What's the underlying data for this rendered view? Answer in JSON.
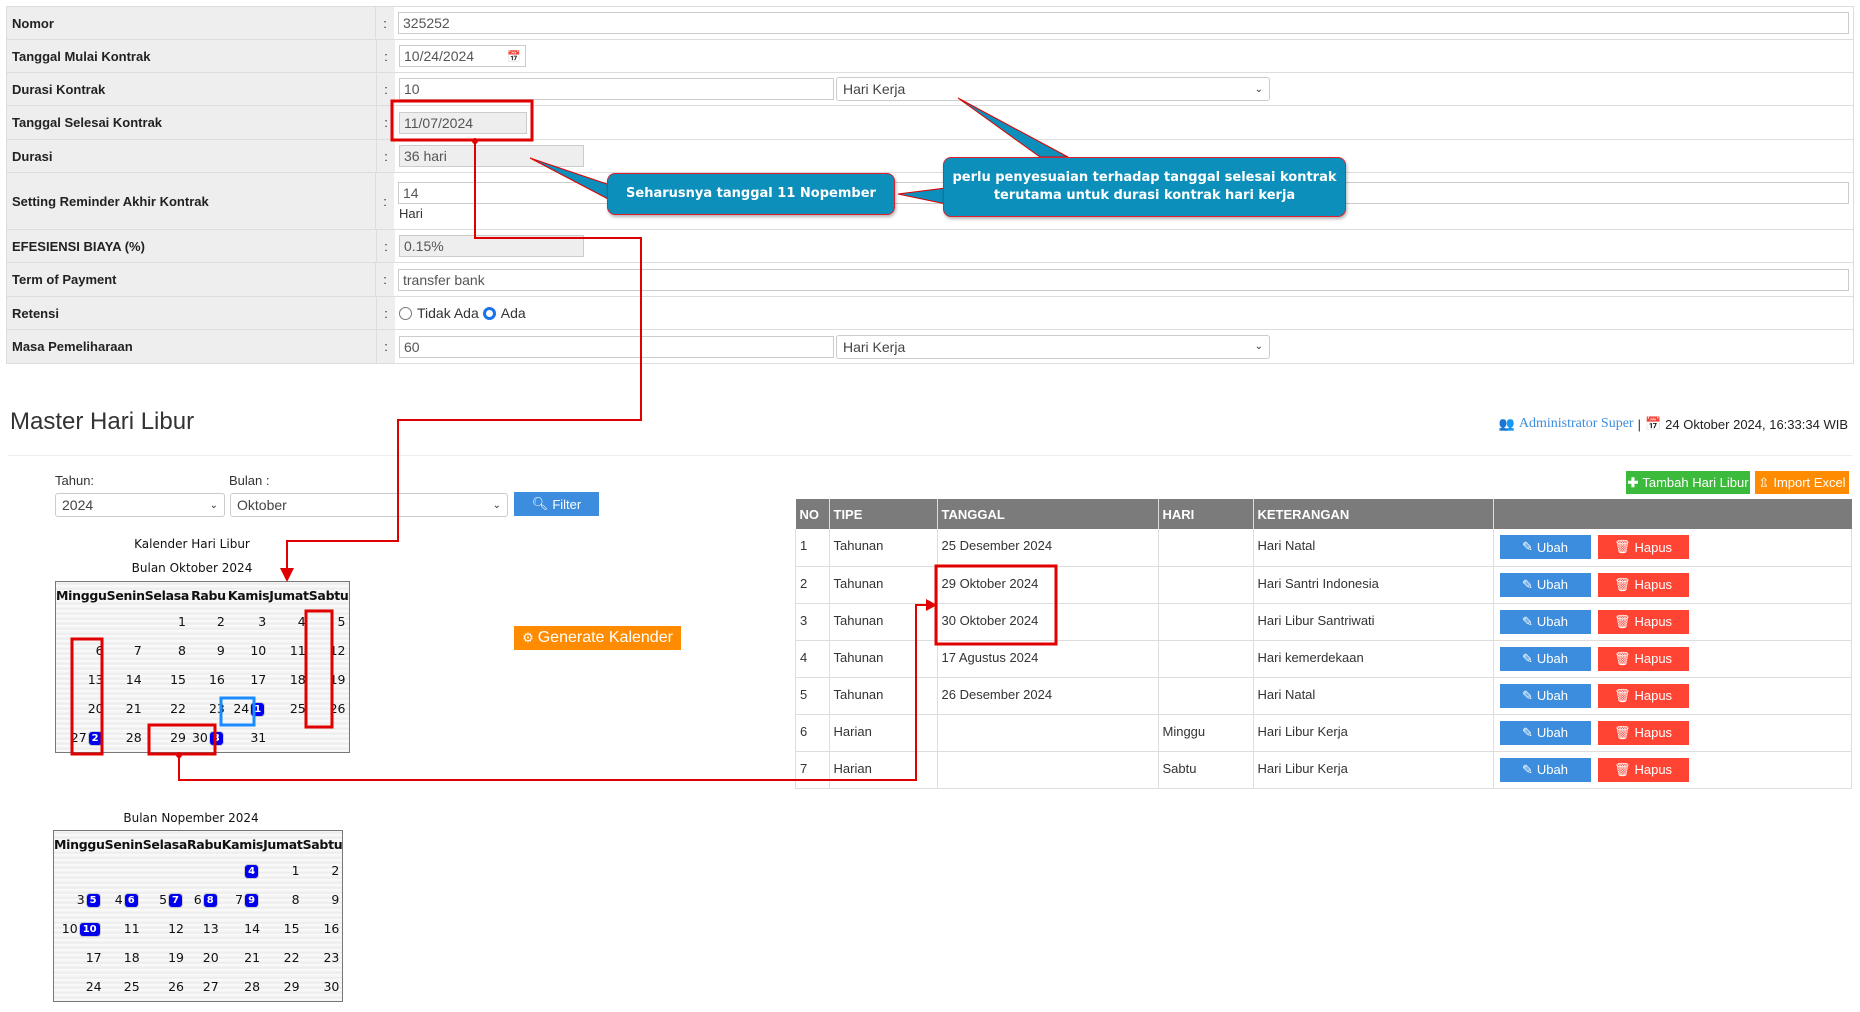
{
  "form": {
    "rows": [
      {
        "label": "Nomor",
        "value": "325252"
      },
      {
        "label": "Tanggal Mulai Kontrak",
        "value": "10/24/2024"
      },
      {
        "label": "Durasi Kontrak",
        "value": "10",
        "unit": "Hari Kerja"
      },
      {
        "label": "Tanggal Selesai Kontrak",
        "value": "11/07/2024"
      },
      {
        "label": "Durasi",
        "value": "36 hari"
      },
      {
        "label": "Setting Reminder Akhir Kontrak",
        "value": "14",
        "unit": "Hari"
      },
      {
        "label": "EFESIENSI BIAYA (%)",
        "value": "0.15%"
      },
      {
        "label": "Term of Payment",
        "value": "transfer bank"
      },
      {
        "label": "Retensi",
        "option1": "Tidak Ada",
        "option2": "Ada",
        "selected": "Ada"
      },
      {
        "label": "Masa Pemeliharaan",
        "value": "60",
        "unit": "Hari Kerja"
      }
    ],
    "colon": ":"
  },
  "annotations": {
    "callout1": "Seharusnya tanggal 11 Nopember",
    "callout2_line1": "perlu penyesuaian terhadap tanggal selesai kontrak",
    "callout2_line2": "terutama untuk durasi kontrak hari kerja",
    "color": "#e00000"
  },
  "header": {
    "title": "Master Hari Libur",
    "user": "Administrator Super",
    "separator": "|",
    "datetime": "24 Oktober 2024, 16:33:34 WIB"
  },
  "filter": {
    "tahun_label": "Tahun:",
    "tahun_value": "2024",
    "bulan_label": "Bulan :",
    "bulan_value": "Oktober",
    "filter_button": "Filter"
  },
  "buttons": {
    "tambah": "Tambah Hari Libur",
    "import": "Import Excel",
    "generate": "Generate Kalender"
  },
  "calendar": {
    "title": "Kalender Hari Libur",
    "days": [
      "Minggu",
      "Senin",
      "Selasa",
      "Rabu",
      "Kamis",
      "Jumat",
      "Sabtu"
    ],
    "months": [
      {
        "title": "Bulan Oktober 2024",
        "weeks": [
          [
            [
              "",
              ""
            ],
            [
              "",
              ""
            ],
            [
              "1",
              ""
            ],
            [
              "2",
              ""
            ],
            [
              "3",
              ""
            ],
            [
              "4",
              ""
            ],
            [
              "5",
              ""
            ]
          ],
          [
            [
              "6",
              ""
            ],
            [
              "7",
              ""
            ],
            [
              "8",
              ""
            ],
            [
              "9",
              ""
            ],
            [
              "10",
              ""
            ],
            [
              "11",
              ""
            ],
            [
              "12",
              ""
            ]
          ],
          [
            [
              "13",
              ""
            ],
            [
              "14",
              ""
            ],
            [
              "15",
              ""
            ],
            [
              "16",
              ""
            ],
            [
              "17",
              ""
            ],
            [
              "18",
              ""
            ],
            [
              "19",
              ""
            ]
          ],
          [
            [
              "20",
              ""
            ],
            [
              "21",
              ""
            ],
            [
              "22",
              ""
            ],
            [
              "23",
              ""
            ],
            [
              "24",
              "1"
            ],
            [
              "25",
              ""
            ],
            [
              "26",
              ""
            ]
          ],
          [
            [
              "27",
              "2"
            ],
            [
              "28",
              ""
            ],
            [
              "29",
              ""
            ],
            [
              "30",
              "3"
            ],
            [
              "31",
              ""
            ],
            [
              "",
              ""
            ],
            [
              "",
              ""
            ]
          ]
        ]
      },
      {
        "title": "Bulan Nopember 2024",
        "weeks": [
          [
            [
              "",
              ""
            ],
            [
              "",
              ""
            ],
            [
              "",
              ""
            ],
            [
              "",
              ""
            ],
            [
              "",
              "4"
            ],
            [
              "1",
              ""
            ],
            [
              "2",
              ""
            ]
          ],
          [
            [
              "3",
              "5"
            ],
            [
              "4",
              "6"
            ],
            [
              "5",
              "7"
            ],
            [
              "6",
              "8"
            ],
            [
              "7",
              "9"
            ],
            [
              "8",
              ""
            ],
            [
              "9",
              ""
            ]
          ],
          [
            [
              "10",
              "10"
            ],
            [
              "11",
              ""
            ],
            [
              "12",
              ""
            ],
            [
              "13",
              ""
            ],
            [
              "14",
              ""
            ],
            [
              "15",
              ""
            ],
            [
              "16",
              ""
            ]
          ],
          [
            [
              "17",
              ""
            ],
            [
              "18",
              ""
            ],
            [
              "19",
              ""
            ],
            [
              "20",
              ""
            ],
            [
              "21",
              ""
            ],
            [
              "22",
              ""
            ],
            [
              "23",
              ""
            ]
          ],
          [
            [
              "24",
              ""
            ],
            [
              "25",
              ""
            ],
            [
              "26",
              ""
            ],
            [
              "27",
              ""
            ],
            [
              "28",
              ""
            ],
            [
              "29",
              ""
            ],
            [
              "30",
              ""
            ]
          ]
        ]
      }
    ]
  },
  "table": {
    "headers": [
      "NO",
      "TIPE",
      "TANGGAL",
      "HARI",
      "KETERANGAN",
      ""
    ],
    "rows": [
      {
        "no": "1",
        "tipe": "Tahunan",
        "tanggal": "25 Desember 2024",
        "hari": "",
        "ket": "Hari Natal"
      },
      {
        "no": "2",
        "tipe": "Tahunan",
        "tanggal": "29 Oktober 2024",
        "hari": "",
        "ket": "Hari Santri Indonesia"
      },
      {
        "no": "3",
        "tipe": "Tahunan",
        "tanggal": "30 Oktober 2024",
        "hari": "",
        "ket": "Hari Libur Santriwati"
      },
      {
        "no": "4",
        "tipe": "Tahunan",
        "tanggal": "17 Agustus 2024",
        "hari": "",
        "ket": "Hari kemerdekaan"
      },
      {
        "no": "5",
        "tipe": "Tahunan",
        "tanggal": "26 Desember 2024",
        "hari": "",
        "ket": "Hari Natal"
      },
      {
        "no": "6",
        "tipe": "Harian",
        "tanggal": "",
        "hari": "Minggu",
        "ket": "Hari Libur Kerja"
      },
      {
        "no": "7",
        "tipe": "Harian",
        "tanggal": "",
        "hari": "Sabtu",
        "ket": "Hari Libur Kerja"
      }
    ],
    "edit_label": "Ubah",
    "delete_label": "Hapus"
  },
  "colors": {
    "primary": "#3c8dde",
    "danger": "#ff4433",
    "success": "#3cba3c",
    "warning": "#ff8c00",
    "callout": "#0c8fbb"
  }
}
